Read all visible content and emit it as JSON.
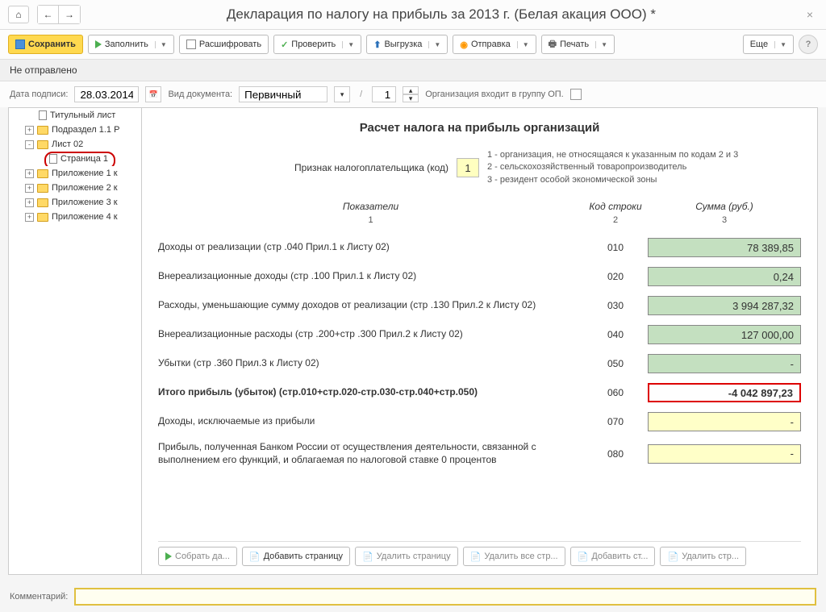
{
  "window": {
    "title": "Декларация по налогу на прибыль за 2013 г. (Белая акация ООО) *"
  },
  "toolbar": {
    "save": "Сохранить",
    "fill": "Заполнить",
    "decode": "Расшифровать",
    "check": "Проверить",
    "export": "Выгрузка",
    "send": "Отправка",
    "print": "Печать",
    "more": "Еще"
  },
  "status": "Не отправлено",
  "form": {
    "sign_date_label": "Дата подписи:",
    "sign_date": "28.03.2014",
    "doc_type_label": "Вид документа:",
    "doc_type": "Первичный",
    "page_num": "1",
    "org_group_label": "Организация входит в группу ОП."
  },
  "tree": {
    "items": [
      {
        "label": "Титульный лист",
        "type": "page",
        "indent": 1
      },
      {
        "label": "Подраздел 1.1 Р",
        "type": "folder",
        "indent": 1,
        "exp": "+"
      },
      {
        "label": "Лист 02",
        "type": "folder",
        "indent": 1,
        "exp": "-"
      },
      {
        "label": "Страница 1",
        "type": "page",
        "indent": 2,
        "selected": true
      },
      {
        "label": "Приложение 1 к",
        "type": "folder",
        "indent": 1,
        "exp": "+"
      },
      {
        "label": "Приложение 2 к",
        "type": "folder",
        "indent": 1,
        "exp": "+"
      },
      {
        "label": "Приложение 3 к",
        "type": "folder",
        "indent": 1,
        "exp": "+"
      },
      {
        "label": "Приложение 4 к",
        "type": "folder",
        "indent": 1,
        "exp": "+"
      }
    ]
  },
  "document": {
    "title": "Расчет налога на прибыль организаций",
    "sign_label": "Признак налогоплательщика (код)",
    "sign_value": "1",
    "hints": [
      "1 - организация, не относящаяся к указанным по кодам 2 и 3",
      "2 - сельскохозяйственный товаропроизводитель",
      "3 - резидент особой экономической зоны"
    ],
    "headers": {
      "ind": "Показатели",
      "code": "Код строки",
      "sum": "Сумма (руб.)"
    },
    "sub": {
      "ind": "1",
      "code": "2",
      "sum": "3"
    },
    "rows": [
      {
        "ind": "Доходы от реализации (стр .040 Прил.1 к Листу 02)",
        "code": "010",
        "sum": "78 389,85",
        "cls": "sum-green"
      },
      {
        "ind": "Внереализационные доходы (стр .100 Прил.1 к Листу 02)",
        "code": "020",
        "sum": "0,24",
        "cls": "sum-green"
      },
      {
        "ind": "Расходы, уменьшающие сумму доходов от реализации (стр .130 Прил.2 к Листу 02)",
        "code": "030",
        "sum": "3 994 287,32",
        "cls": "sum-green"
      },
      {
        "ind": "Внереализационные расходы (стр .200+стр .300 Прил.2 к Листу 02)",
        "code": "040",
        "sum": "127 000,00",
        "cls": "sum-green"
      },
      {
        "ind": "Убытки (стр .360 Прил.3 к Листу 02)",
        "code": "050",
        "sum": "-",
        "cls": "sum-green"
      },
      {
        "ind": "Итого прибыль (убыток)        (стр.010+стр.020-стр.030-стр.040+стр.050)",
        "code": "060",
        "sum": "-4 042 897,23",
        "cls": "sum-red",
        "bold": true
      },
      {
        "ind": "Доходы, исключаемые из прибыли",
        "code": "070",
        "sum": "-",
        "cls": "sum-yellow"
      },
      {
        "ind": "Прибыль, полученная Банком России от осуществления деятельности, связанной с выполнением его функций, и облагаемая по налоговой ставке 0 процентов",
        "code": "080",
        "sum": "-",
        "cls": "sum-yellow"
      }
    ]
  },
  "bottom": {
    "collect": "Собрать да...",
    "add_page": "Добавить страницу",
    "del_page": "Удалить страницу",
    "del_all": "Удалить все стр...",
    "add_st": "Добавить ст...",
    "del_st": "Удалить стр..."
  },
  "comment_label": "Комментарий:"
}
